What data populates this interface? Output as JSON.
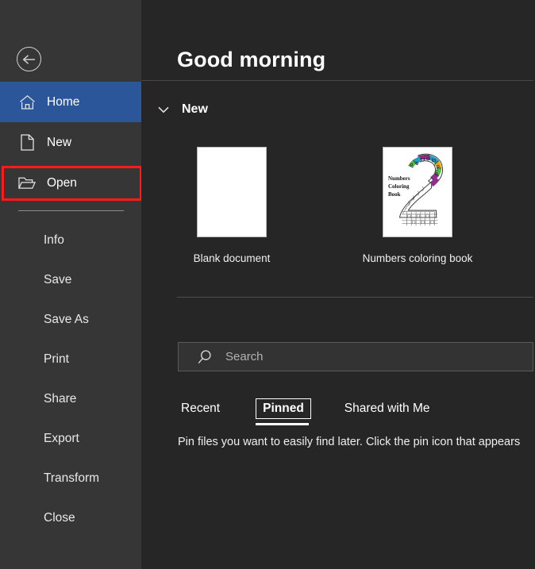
{
  "window": {
    "greeting": "Good morning"
  },
  "sidebar": {
    "back_icon": "back-arrow-icon",
    "top_items": [
      {
        "label": "Home",
        "icon": "home-icon",
        "active": true
      },
      {
        "label": "New",
        "icon": "new-document-icon",
        "active": false
      },
      {
        "label": "Open",
        "icon": "open-folder-icon",
        "active": false
      }
    ],
    "bottom_items": [
      {
        "label": "Info"
      },
      {
        "label": "Save"
      },
      {
        "label": "Save As"
      },
      {
        "label": "Print"
      },
      {
        "label": "Share"
      },
      {
        "label": "Export"
      },
      {
        "label": "Transform"
      },
      {
        "label": "Close"
      }
    ],
    "highlight_color": "#ff1b1b",
    "active_color": "#2b579a",
    "background": "#363636"
  },
  "main": {
    "background": "#262626",
    "new_section": {
      "title": "New",
      "chevron_icon": "chevron-down-icon",
      "templates": [
        {
          "name": "Blank document",
          "type": "blank"
        },
        {
          "name": "Numbers coloring book",
          "type": "cover",
          "cover_title_lines": "Numbers\nColoring\nBook"
        }
      ]
    },
    "search": {
      "placeholder": "Search",
      "value": "",
      "icon": "search-icon"
    },
    "tabs": [
      {
        "label": "Recent",
        "selected": false
      },
      {
        "label": "Pinned",
        "selected": true
      },
      {
        "label": "Shared with Me",
        "selected": false
      }
    ],
    "hint": "Pin files you want to easily find later. Click the pin icon that appears"
  }
}
